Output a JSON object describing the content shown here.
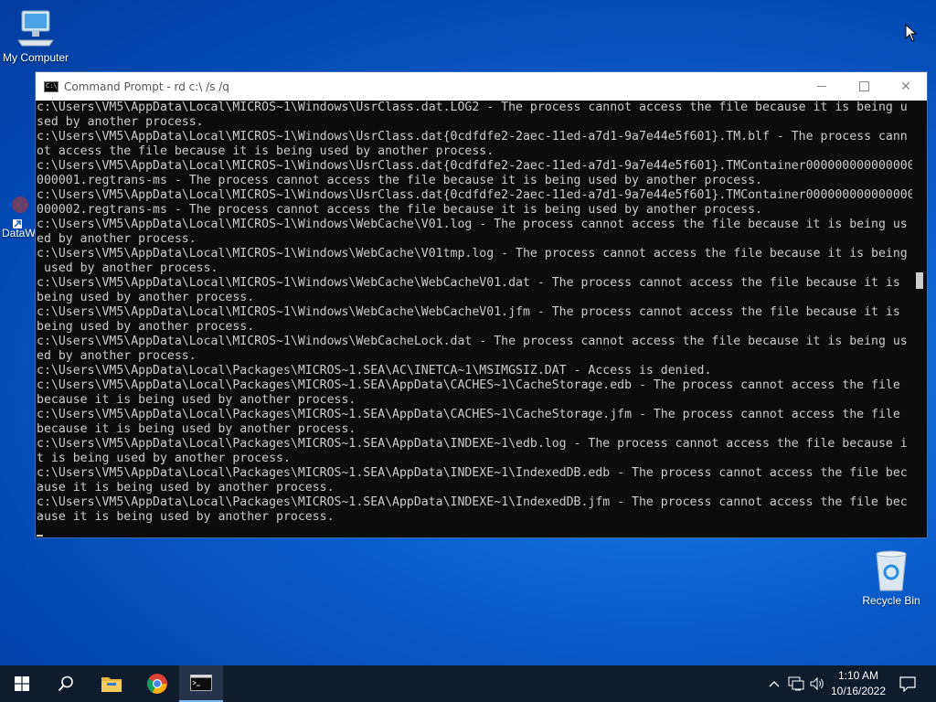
{
  "desktop": {
    "icons": {
      "my_computer": "My Computer",
      "recycle_bin": "Recycle Bin",
      "dataw": "DataW"
    }
  },
  "window": {
    "title": "Command Prompt - rd  c:\\ /s /q",
    "min_glyph": "—",
    "max_glyph": "☐",
    "close_glyph": "✕",
    "app_icon_text": "C:\\_"
  },
  "console": {
    "lines": [
      "c:\\Users\\VM5\\AppData\\Local\\MICROS~1\\Windows\\UsrClass.dat.LOG2 - The process cannot access the file because it is being u",
      "sed by another process.",
      "c:\\Users\\VM5\\AppData\\Local\\MICROS~1\\Windows\\UsrClass.dat{0cdfdfe2-2aec-11ed-a7d1-9a7e44e5f601}.TM.blf - The process cann",
      "ot access the file because it is being used by another process.",
      "c:\\Users\\VM5\\AppData\\Local\\MICROS~1\\Windows\\UsrClass.dat{0cdfdfe2-2aec-11ed-a7d1-9a7e44e5f601}.TMContainer000000000000000",
      "000001.regtrans-ms - The process cannot access the file because it is being used by another process.",
      "c:\\Users\\VM5\\AppData\\Local\\MICROS~1\\Windows\\UsrClass.dat{0cdfdfe2-2aec-11ed-a7d1-9a7e44e5f601}.TMContainer000000000000000",
      "000002.regtrans-ms - The process cannot access the file because it is being used by another process.",
      "c:\\Users\\VM5\\AppData\\Local\\MICROS~1\\Windows\\WebCache\\V01.log - The process cannot access the file because it is being us",
      "ed by another process.",
      "c:\\Users\\VM5\\AppData\\Local\\MICROS~1\\Windows\\WebCache\\V01tmp.log - The process cannot access the file because it is being",
      " used by another process.",
      "c:\\Users\\VM5\\AppData\\Local\\MICROS~1\\Windows\\WebCache\\WebCacheV01.dat - The process cannot access the file because it is",
      "being used by another process.",
      "c:\\Users\\VM5\\AppData\\Local\\MICROS~1\\Windows\\WebCache\\WebCacheV01.jfm - The process cannot access the file because it is",
      "being used by another process.",
      "c:\\Users\\VM5\\AppData\\Local\\MICROS~1\\Windows\\WebCacheLock.dat - The process cannot access the file because it is being us",
      "ed by another process.",
      "c:\\Users\\VM5\\AppData\\Local\\Packages\\MICROS~1.SEA\\AC\\INETCA~1\\MSIMGSIZ.DAT - Access is denied.",
      "c:\\Users\\VM5\\AppData\\Local\\Packages\\MICROS~1.SEA\\AppData\\CACHES~1\\CacheStorage.edb - The process cannot access the file",
      "because it is being used by another process.",
      "c:\\Users\\VM5\\AppData\\Local\\Packages\\MICROS~1.SEA\\AppData\\CACHES~1\\CacheStorage.jfm - The process cannot access the file",
      "because it is being used by another process.",
      "c:\\Users\\VM5\\AppData\\Local\\Packages\\MICROS~1.SEA\\AppData\\INDEXE~1\\edb.log - The process cannot access the file because i",
      "t is being used by another process.",
      "c:\\Users\\VM5\\AppData\\Local\\Packages\\MICROS~1.SEA\\AppData\\INDEXE~1\\IndexedDB.edb - The process cannot access the file bec",
      "ause it is being used by another process.",
      "c:\\Users\\VM5\\AppData\\Local\\Packages\\MICROS~1.SEA\\AppData\\INDEXE~1\\IndexedDB.jfm - The process cannot access the file bec",
      "ause it is being used by another process."
    ]
  },
  "taskbar": {
    "pinned": [
      "start-button",
      "search-button",
      "file-explorer",
      "chrome",
      "command-prompt"
    ],
    "active": "command-prompt",
    "accent_color": "#76b9ed"
  },
  "tray": {
    "time": "1:10 AM",
    "date": "10/16/2022"
  },
  "colors": {
    "console_bg": "#0c0c0c",
    "console_fg": "#cccccc",
    "taskbar_bg": "#101b2e"
  }
}
